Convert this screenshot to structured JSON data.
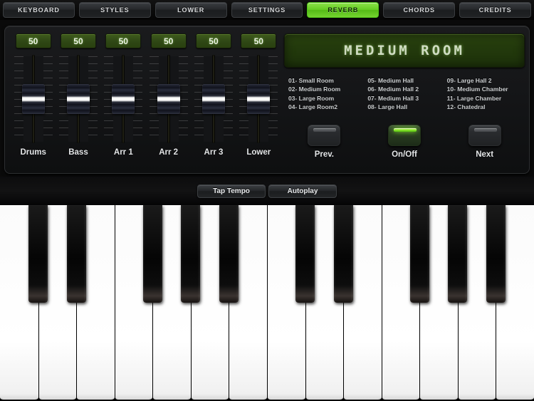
{
  "tabs": [
    {
      "label": "KEYBOARD",
      "active": false
    },
    {
      "label": "STYLES",
      "active": false
    },
    {
      "label": "LOWER",
      "active": false
    },
    {
      "label": "SETTINGS",
      "active": false
    },
    {
      "label": "REVERB",
      "active": true
    },
    {
      "label": "CHORDS",
      "active": false
    },
    {
      "label": "CREDITS",
      "active": false
    }
  ],
  "mixer": {
    "faders": [
      {
        "label": "Drums",
        "value": "50"
      },
      {
        "label": "Bass",
        "value": "50"
      },
      {
        "label": "Arr 1",
        "value": "50"
      },
      {
        "label": "Arr 2",
        "value": "50"
      },
      {
        "label": "Arr 3",
        "value": "50"
      },
      {
        "label": "Lower",
        "value": "50"
      }
    ]
  },
  "reverb": {
    "display": "MEDIUM ROOM",
    "presets_col1": [
      "01- Small Room",
      "02- Medium Room",
      "03- Large Room",
      "04- Large Room2"
    ],
    "presets_col2": [
      "05- Medium Hall",
      "06- Medium Hall 2",
      "07- Medium Hall 3",
      "08- Large Hall"
    ],
    "presets_col3": [
      "09- Large Hall 2",
      "10- Medium Chamber",
      "11- Large Chamber",
      "12- Chatedral"
    ],
    "prev_label": "Prev.",
    "onoff_label": "On/Off",
    "next_label": "Next",
    "onoff_active": true
  },
  "tempo": {
    "tap_tempo_label": "Tap Tempo",
    "autoplay_label": "Autoplay"
  },
  "piano": {
    "white_key_count": 14,
    "black_key_offsets": [
      0,
      1,
      3,
      4,
      5,
      7,
      8,
      10,
      11,
      12
    ],
    "colors": {
      "accent_green": "#66cc22",
      "lcd_green": "#233a0c",
      "panel_dark": "#141517"
    }
  }
}
